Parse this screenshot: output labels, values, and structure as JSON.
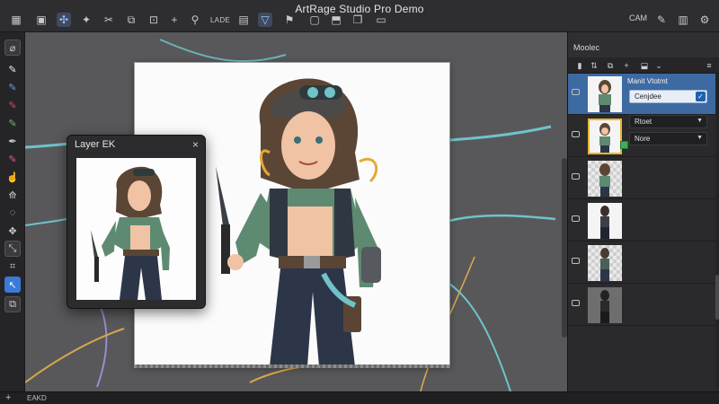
{
  "window": {
    "title": "ArtRage Studio Pro Demo"
  },
  "toolbar": {
    "label_lade": "LADE",
    "label_cam": "CAM"
  },
  "reference_window": {
    "title": "Layer EK",
    "close": "×"
  },
  "layer_panel": {
    "title": "Moolec",
    "layers": [
      {
        "name": "Manit Vtotmt",
        "blend": "Cenjdee",
        "selected": true
      },
      {
        "name": "",
        "blend": "Rtoet"
      },
      {
        "name": "",
        "blend": "Nore"
      },
      {
        "name": ""
      },
      {
        "name": ""
      },
      {
        "name": ""
      }
    ]
  },
  "statusbar": {
    "text": "EAKD"
  },
  "colors": {
    "accent": "#3d6aa1",
    "canvas_bg": "#58585a",
    "stroke_teal": "#6fc3c9",
    "stroke_gold": "#d9a84a",
    "stroke_lavender": "#9b8ccf"
  }
}
